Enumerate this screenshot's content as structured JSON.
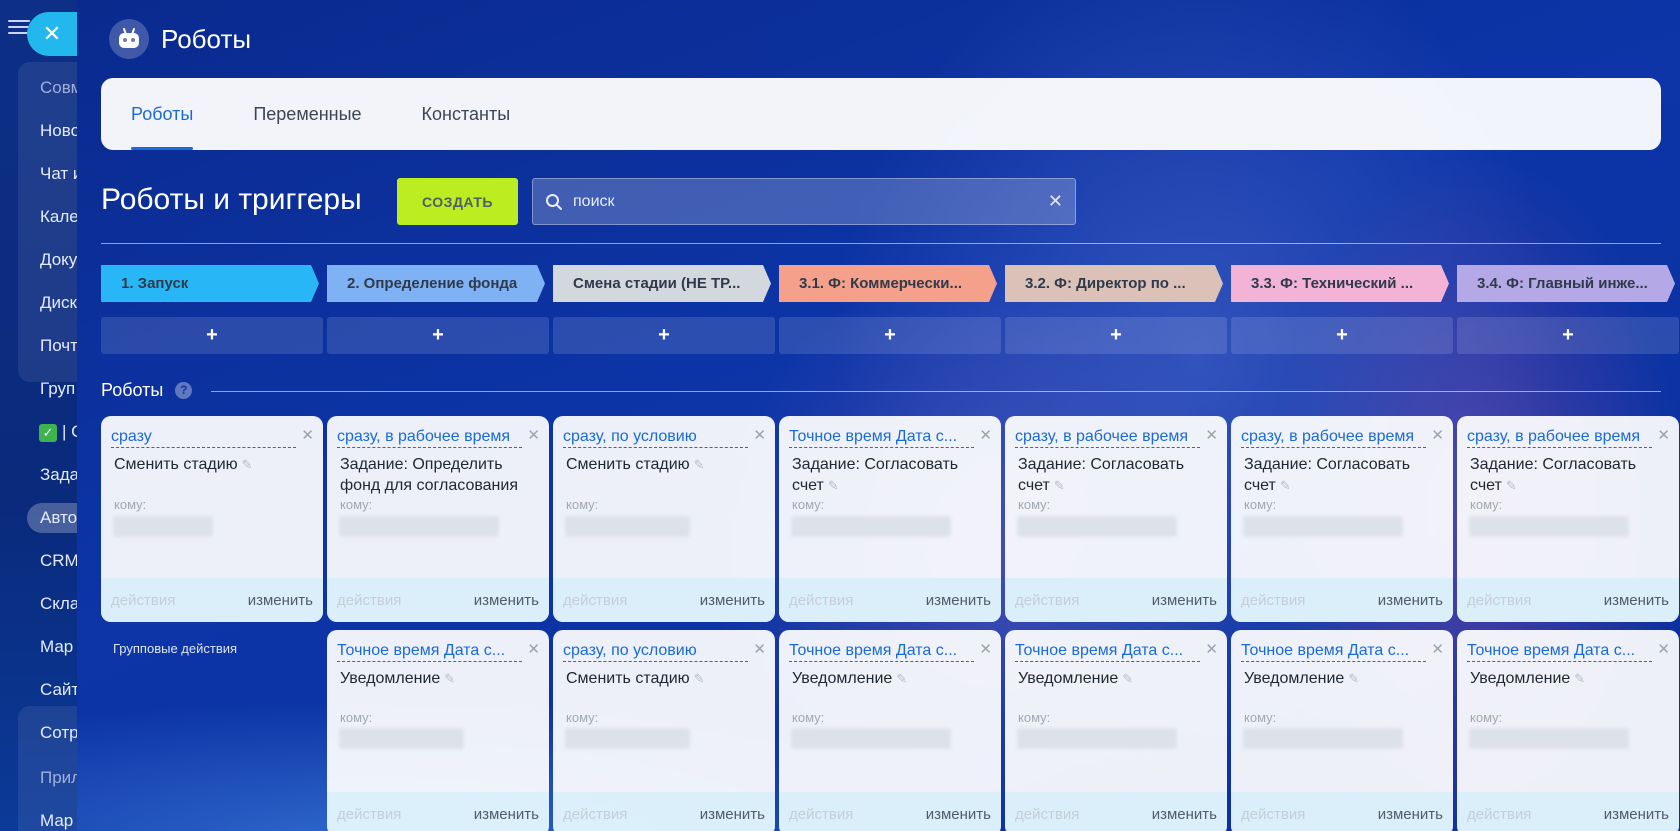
{
  "sidebar": {
    "items": [
      "Совм",
      "Ново",
      "Чат и",
      "Кале",
      "Доку",
      "Диск",
      "Почт",
      "Груп",
      "| С",
      "Зада",
      "Авто",
      "CRM",
      "Скла",
      "Мар",
      "Сайт",
      "Сотр",
      "Прил",
      "Мар"
    ]
  },
  "panel": {
    "title": "Роботы",
    "tabs": [
      "Роботы",
      "Переменные",
      "Константы"
    ]
  },
  "toolbar": {
    "title": "Роботы и триггеры",
    "create_label": "СОЗДАТЬ",
    "search_placeholder": "поиск"
  },
  "stages": [
    {
      "label": "1. Запуск",
      "color": "#29b6f6"
    },
    {
      "label": "2. Определение фонда",
      "color": "#7fb2f5"
    },
    {
      "label": "Смена стадии (НЕ ТР...",
      "color": "#d3d8df"
    },
    {
      "label": "3.1. Ф: Коммерчески...",
      "color": "#f4a08a"
    },
    {
      "label": "3.2. Ф: Директор по ...",
      "color": "#dcc1b8"
    },
    {
      "label": "3.3. Ф: Технический ...",
      "color": "#f3b3d6"
    },
    {
      "label": "3.4. Ф: Главный инже...",
      "color": "#b5a8e6"
    }
  ],
  "stage_add_label": "+",
  "robots_section": {
    "title": "Роботы",
    "help": "?",
    "group_actions": "Групповые действия",
    "to_label": "кому:",
    "actions_label": "действия",
    "edit_label": "изменить"
  },
  "robots_row1": [
    {
      "condition": "сразу",
      "title": "Сменить стадию"
    },
    {
      "condition": "сразу, в рабочее время",
      "title": "Задание: Определить фонд для согласования"
    },
    {
      "condition": "сразу, по условию",
      "title": "Сменить стадию"
    },
    {
      "condition": "Точное время Дата с...",
      "title": "Задание: Согласовать счет"
    },
    {
      "condition": "сразу, в рабочее время",
      "title": "Задание: Согласовать счет"
    },
    {
      "condition": "сразу, в рабочее время",
      "title": "Задание: Согласовать счет"
    },
    {
      "condition": "сразу, в рабочее время",
      "title": "Задание: Согласовать счет"
    }
  ],
  "robots_row2": [
    {
      "condition": "Точное время Дата с...",
      "title": "Уведомление"
    },
    {
      "condition": "сразу, по условию",
      "title": "Сменить стадию"
    },
    {
      "condition": "Точное время Дата с...",
      "title": "Уведомление"
    },
    {
      "condition": "Точное время Дата с...",
      "title": "Уведомление"
    },
    {
      "condition": "Точное время Дата с...",
      "title": "Уведомление"
    },
    {
      "condition": "Точное время Дата с...",
      "title": "Уведомление"
    }
  ]
}
